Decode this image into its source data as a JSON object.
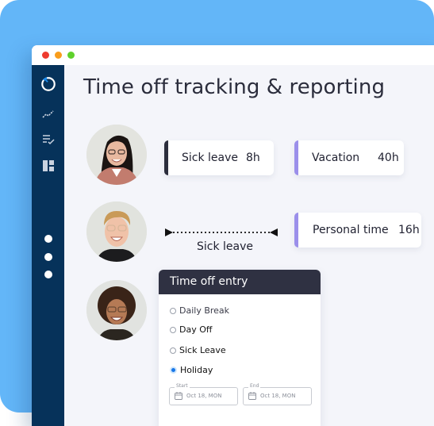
{
  "window": {
    "traffic_lights": [
      "close",
      "minimize",
      "maximize"
    ]
  },
  "sidebar": {
    "icons": [
      {
        "name": "loading-ring-icon"
      },
      {
        "name": "analytics-icon"
      },
      {
        "name": "checklist-icon"
      },
      {
        "name": "dashboard-icon"
      }
    ],
    "dots": 3
  },
  "page": {
    "title": "Time off tracking & reporting"
  },
  "rows": [
    {
      "avatar": "avatar-woman-dark-curly-hair",
      "cards": [
        {
          "label": "Sick leave",
          "hours": "8h",
          "accent": "#2b2d3c"
        },
        {
          "label": "Vacation",
          "hours": "40h",
          "accent": "#9b8fea"
        }
      ]
    },
    {
      "avatar": "avatar-man-blond-hair",
      "range": {
        "label": "Sick leave"
      },
      "cards": [
        {
          "label": "Personal time",
          "hours": "16h",
          "accent": "#9b8fea"
        }
      ]
    },
    {
      "avatar": "avatar-woman-curly-hair-glasses"
    }
  ],
  "entry_form": {
    "title": "Time off entry",
    "options": [
      {
        "label": "Daily Break",
        "selected": false
      },
      {
        "label": "Day Off",
        "selected": false
      },
      {
        "label": "Sick Leave",
        "selected": false
      },
      {
        "label": "Holiday",
        "selected": true
      }
    ],
    "start": {
      "legend": "Start",
      "value": "Oct 18, MON"
    },
    "end": {
      "legend": "End",
      "value": "Oct 18, MON"
    }
  },
  "colors": {
    "background": "#63b6f8",
    "sidebar": "#06325a",
    "accent_dark": "#2b2d3c",
    "accent_purple": "#9b8fea",
    "form_header": "#2f3142",
    "radio_selected": "#1877e8"
  }
}
